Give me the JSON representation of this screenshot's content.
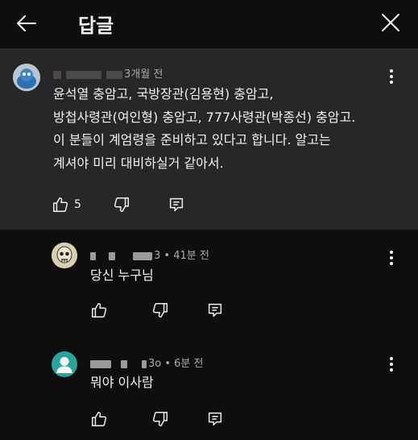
{
  "header": {
    "title": "답글"
  },
  "parent_comment": {
    "time": "3개월 전",
    "lines": [
      "윤석열 충암고, 국방장관(김용현) 충암고,",
      "방첩사령관(여인형) 충암고, 777사령관(박종선) 충암고.",
      "이 분들이 계엄령을 준비하고 있다고 합니다. 알고는",
      "계셔야 미리 대비하실거 같아서."
    ],
    "like_count": "5"
  },
  "replies": [
    {
      "meta_suffix": "3 • 41분 전",
      "text": "당신 누구님"
    },
    {
      "meta_suffix": "3o • 6분 전",
      "text": "뭐야 이사람"
    }
  ],
  "colors": {
    "background": "#0f0f0f",
    "highlight": "#272727",
    "text": "#f1f1f1",
    "meta": "#aaaaaa",
    "avatar_teal": "#26a69a"
  },
  "icons": [
    "back-arrow-icon",
    "close-icon",
    "more-vert-icon",
    "thumbs-up-icon",
    "thumbs-down-icon",
    "reply-icon"
  ]
}
